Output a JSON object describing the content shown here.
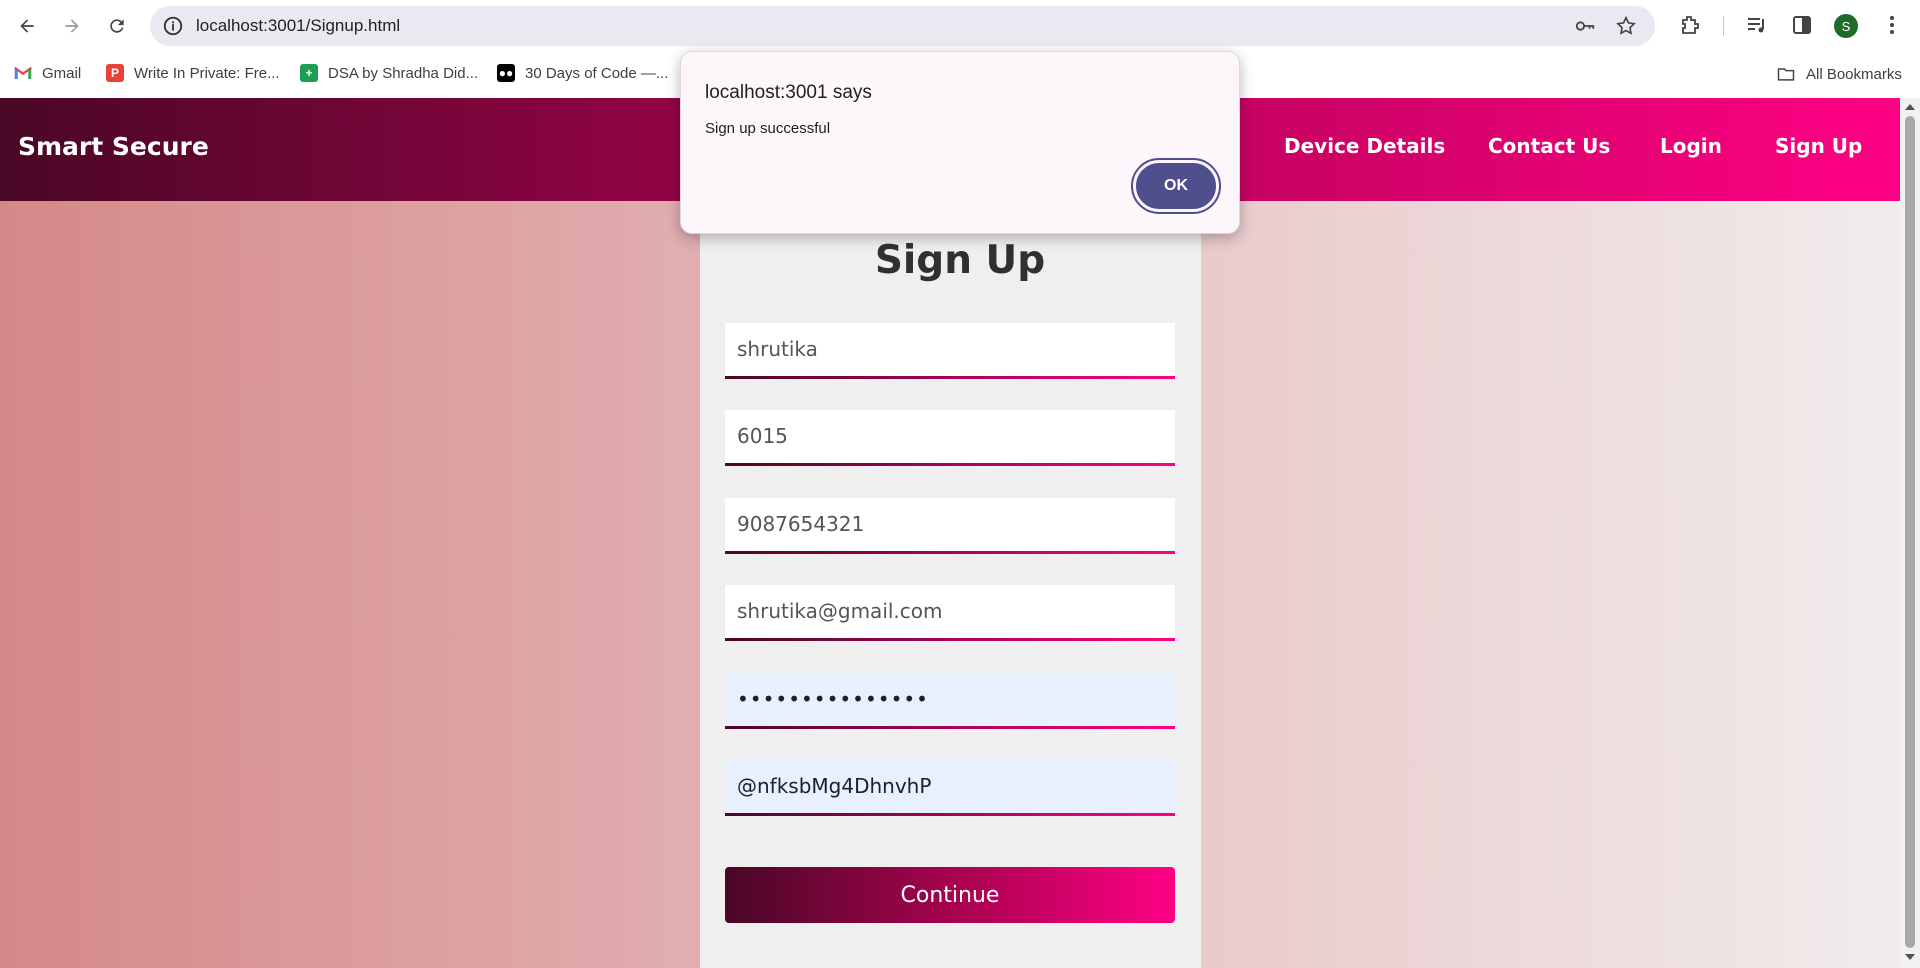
{
  "browser": {
    "url": "localhost:3001/Signup.html",
    "avatar_letter": "S",
    "bookmarks": [
      {
        "label": "Gmail",
        "icon": "gmail-icon"
      },
      {
        "label": "Write In Private: Fre...",
        "icon": "write-in-private-icon"
      },
      {
        "label": "DSA by Shradha Did...",
        "icon": "sheets-icon"
      },
      {
        "label": "30 Days of Code —...",
        "icon": "medium-icon"
      }
    ],
    "all_bookmarks": "All Bookmarks"
  },
  "site": {
    "brand": "Smart Secure",
    "nav": [
      "Device Details",
      "Contact Us",
      "Login",
      "Sign Up"
    ]
  },
  "form": {
    "title": "Sign Up",
    "fields": [
      {
        "value": "shrutika",
        "autofill": false
      },
      {
        "value": "6015",
        "autofill": false
      },
      {
        "value": "9087654321",
        "autofill": false
      },
      {
        "value": "shrutika@gmail.com",
        "autofill": false
      },
      {
        "value": "•••••••••••••••",
        "autofill": true
      },
      {
        "value": "@nfksbMg4DhnvhP",
        "autofill": true
      }
    ],
    "submit_label": "Continue"
  },
  "dialog": {
    "title": "localhost:3001 says",
    "message": "Sign up successful",
    "ok_label": "OK"
  },
  "colors": {
    "nav_gradient_start": "#4a0726",
    "nav_gradient_end": "#ff0184",
    "dialog_button": "#4f4f8e"
  }
}
